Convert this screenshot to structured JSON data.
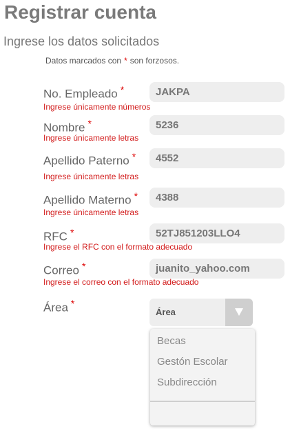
{
  "page": {
    "title": "Registrar cuenta",
    "subtitle": "Ingrese los datos solicitados",
    "note_prefix": "Datos marcados con",
    "note_star": "*",
    "note_suffix": "son forzosos."
  },
  "fields": [
    {
      "label": "No. Empleado",
      "value": "JAKPA",
      "error": "Ingrese únicamente números"
    },
    {
      "label": "Nombre",
      "value": "5236",
      "error": "Ingrese únicamente letras"
    },
    {
      "label": "Apellido Paterno",
      "value": "4552",
      "error": "Ingrese únicamente letras"
    },
    {
      "label": "Apellido Materno",
      "value": "4388",
      "error": "Ingrese únicamente letras"
    },
    {
      "label": "RFC",
      "value": "52TJ851203LLO4",
      "error": "Ingrese el RFC con el formato adecuado"
    },
    {
      "label": "Correo",
      "value": "juanito_yahoo.com",
      "error": "Ingrese el correo con el formato adecuado"
    }
  ],
  "area": {
    "label": "Área",
    "selected": "Área",
    "options": [
      "Becas",
      "Gestón Escolar",
      "Subdirección"
    ]
  },
  "colors": {
    "error": "#d21a1a",
    "required_star": "#d00000",
    "input_bg": "#eeeeee"
  }
}
